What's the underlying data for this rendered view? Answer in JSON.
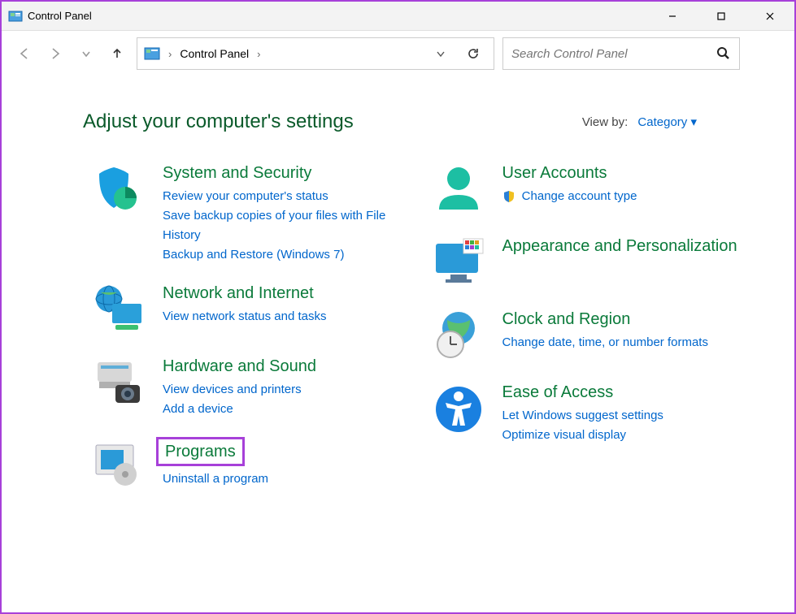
{
  "titlebar": {
    "title": "Control Panel"
  },
  "address": {
    "path": "Control Panel"
  },
  "search": {
    "placeholder": "Search Control Panel"
  },
  "header": {
    "title": "Adjust your computer's settings",
    "view_by_label": "View by:",
    "view_by_value": "Category"
  },
  "left_column": [
    {
      "title": "System and Security",
      "links": [
        "Review your computer's status",
        "Save backup copies of your files with File History",
        "Backup and Restore (Windows 7)"
      ]
    },
    {
      "title": "Network and Internet",
      "links": [
        "View network status and tasks"
      ]
    },
    {
      "title": "Hardware and Sound",
      "links": [
        "View devices and printers",
        "Add a device"
      ]
    },
    {
      "title": "Programs",
      "highlighted": true,
      "links": [
        "Uninstall a program"
      ]
    }
  ],
  "right_column": [
    {
      "title": "User Accounts",
      "links": [
        "Change account type"
      ],
      "link_icon": true
    },
    {
      "title": "Appearance and Personalization",
      "links": []
    },
    {
      "title": "Clock and Region",
      "links": [
        "Change date, time, or number formats"
      ]
    },
    {
      "title": "Ease of Access",
      "links": [
        "Let Windows suggest settings",
        "Optimize visual display"
      ]
    }
  ]
}
